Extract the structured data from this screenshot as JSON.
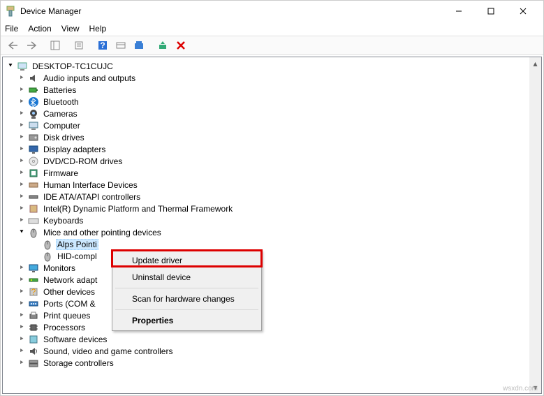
{
  "window": {
    "title": "Device Manager"
  },
  "menu": {
    "file": "File",
    "action": "Action",
    "view": "View",
    "help": "Help"
  },
  "root": {
    "name": "DESKTOP-TC1CUJC"
  },
  "categories": [
    {
      "id": "audio",
      "label": "Audio inputs and outputs",
      "expanded": false
    },
    {
      "id": "batt",
      "label": "Batteries",
      "expanded": false
    },
    {
      "id": "bt",
      "label": "Bluetooth",
      "expanded": false
    },
    {
      "id": "cam",
      "label": "Cameras",
      "expanded": false
    },
    {
      "id": "comp",
      "label": "Computer",
      "expanded": false
    },
    {
      "id": "disk",
      "label": "Disk drives",
      "expanded": false
    },
    {
      "id": "disp",
      "label": "Display adapters",
      "expanded": false
    },
    {
      "id": "dvd",
      "label": "DVD/CD-ROM drives",
      "expanded": false
    },
    {
      "id": "fw",
      "label": "Firmware",
      "expanded": false
    },
    {
      "id": "hid",
      "label": "Human Interface Devices",
      "expanded": false
    },
    {
      "id": "ide",
      "label": "IDE ATA/ATAPI controllers",
      "expanded": false
    },
    {
      "id": "intel",
      "label": "Intel(R) Dynamic Platform and Thermal Framework",
      "expanded": false
    },
    {
      "id": "kb",
      "label": "Keyboards",
      "expanded": false
    },
    {
      "id": "mice",
      "label": "Mice and other pointing devices",
      "expanded": true
    },
    {
      "id": "mon",
      "label": "Monitors",
      "expanded": false
    },
    {
      "id": "net",
      "label": "Network adapt",
      "expanded": false
    },
    {
      "id": "other",
      "label": "Other devices",
      "expanded": false
    },
    {
      "id": "ports",
      "label": "Ports (COM &",
      "expanded": false
    },
    {
      "id": "printq",
      "label": "Print queues",
      "expanded": false
    },
    {
      "id": "proc",
      "label": "Processors",
      "expanded": false
    },
    {
      "id": "sw",
      "label": "Software devices",
      "expanded": false
    },
    {
      "id": "svg",
      "label": "Sound, video and game controllers",
      "expanded": false
    },
    {
      "id": "storage",
      "label": "Storage controllers",
      "expanded": false
    }
  ],
  "mice_children": [
    {
      "id": "alps",
      "label": "Alps Pointi",
      "selected": true
    },
    {
      "id": "hidm",
      "label": "HID-compl",
      "selected": false
    }
  ],
  "context": {
    "update": "Update driver",
    "uninstall": "Uninstall device",
    "scan": "Scan for hardware changes",
    "props": "Properties"
  },
  "watermark": "wsxdn.com"
}
